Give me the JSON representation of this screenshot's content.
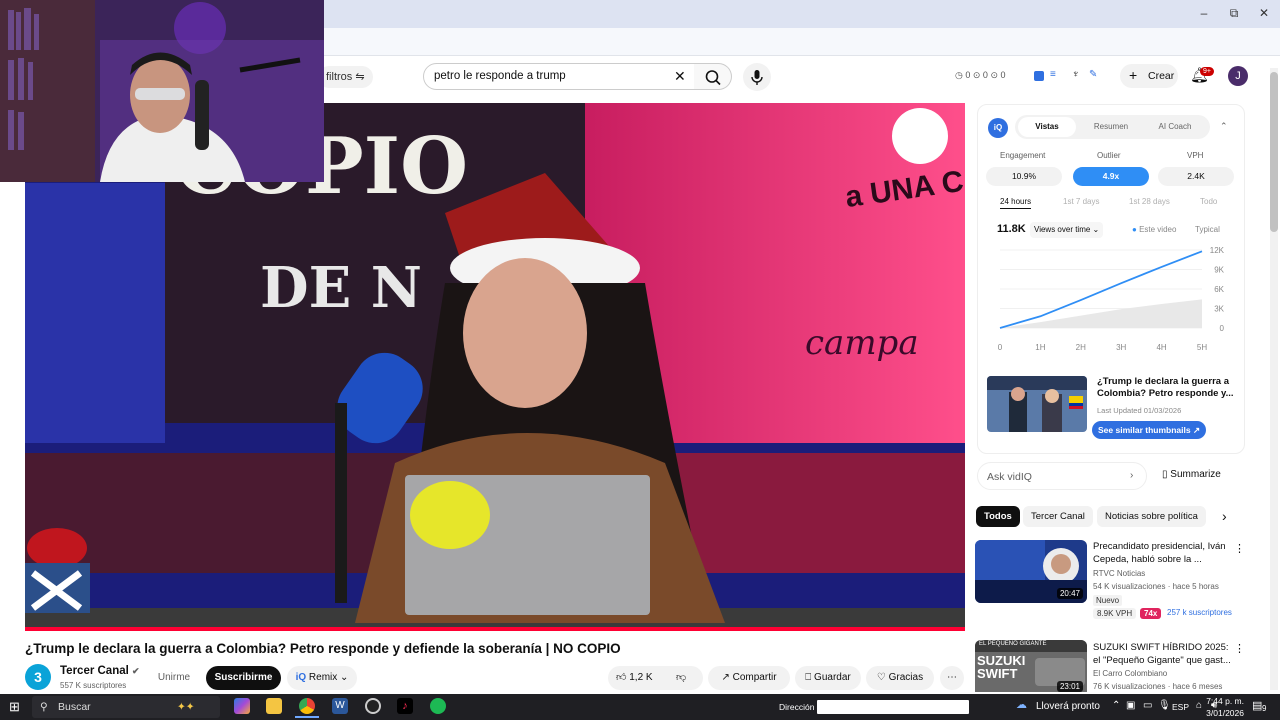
{
  "browser": {
    "minimize": "–",
    "restore": "⧉",
    "close": "✕",
    "profile_initial": "J"
  },
  "youtube": {
    "filters_label": "filtros",
    "search_value": "petro le responde a trump",
    "counters": [
      "0",
      "0",
      "0"
    ],
    "create_label": "Crear",
    "notifications_badge": "9+",
    "avatar_initial": "J"
  },
  "video": {
    "title": "¿Trump le declara la guerra a Colombia? Petro responde y defiende la soberanía | NO COPIO",
    "channel_name": "Tercer Canal",
    "channel_avatar_initial": "3",
    "subscribers": "557 K suscriptores",
    "join_label": "Unirme",
    "subscribe_label": "Suscribirme",
    "remix_label": "Remix",
    "likes": "1,2 K",
    "share_label": "Compartir",
    "save_label": "Guardar",
    "thanks_label": "Gracias",
    "wall_text_top": "COPIO",
    "wall_text_bottom": "DE N",
    "wall_text_right": "a UNA C",
    "wall_text_script": "campa"
  },
  "vidiq": {
    "logo": "iQ",
    "tabs": [
      "Vistas",
      "Resumen",
      "AI Coach"
    ],
    "metrics": [
      {
        "label": "Engagement",
        "value": "10.9%"
      },
      {
        "label": "Outlier",
        "value": "4.9x"
      },
      {
        "label": "VPH",
        "value": "2.4K"
      }
    ],
    "ranges": [
      "24 hours",
      "1st 7 days",
      "1st 28 days",
      "Todo"
    ],
    "total_views": "11.8K",
    "views_dropdown": "Views over time",
    "legend_this": "Este video",
    "legend_typical": "Typical",
    "thumb_title": "¿Trump le declara la guerra a Colombia? Petro responde y...",
    "last_updated": "Last Updated 01/03/2026",
    "similar_button": "See similar thumbnails",
    "ask_placeholder": "Ask vidIQ",
    "summarize_label": "Summarize"
  },
  "chart_data": {
    "type": "line",
    "x": [
      "0",
      "1H",
      "2H",
      "3H",
      "4H",
      "5H"
    ],
    "y_ticks": [
      "0",
      "3K",
      "6K",
      "9K",
      "12K"
    ],
    "ylim": [
      0,
      12000
    ],
    "series": [
      {
        "name": "Este video",
        "values": [
          0,
          1800,
          4300,
          6900,
          9400,
          11800
        ]
      },
      {
        "name": "Typical",
        "values": [
          0,
          900,
          1900,
          2900,
          3700,
          4400
        ]
      }
    ]
  },
  "chips": [
    "Todos",
    "Tercer Canal",
    "Noticias sobre política"
  ],
  "related": [
    {
      "title": "Precandidato presidencial, Iván Cepeda, habló sobre la ...",
      "channel": "RTVC Noticias",
      "meta": "54 K visualizaciones · hace 5 horas",
      "badge": "Nuevo",
      "duration": "20:47",
      "vph": "8.9K VPH",
      "outlier": "74x",
      "subs": "257 k suscriptores"
    },
    {
      "title": "SUZUKI SWIFT HÍBRIDO 2025: el \"Pequeño Gigante\" que gast...",
      "channel": "El Carro Colombiano",
      "meta": "76 K visualizaciones · hace 6 meses",
      "thumb_text": "SUZUKI SWIFT",
      "thumb_tag": "EL PEQUEÑO GIGANTE",
      "duration": "23:01"
    }
  ],
  "taskbar": {
    "search_label": "Buscar",
    "address_label": "Dirección",
    "weather": "Lloverá pronto",
    "language": "ESP",
    "time": "7:44 p. m.",
    "date": "3/01/2026",
    "notif_count": "9"
  }
}
